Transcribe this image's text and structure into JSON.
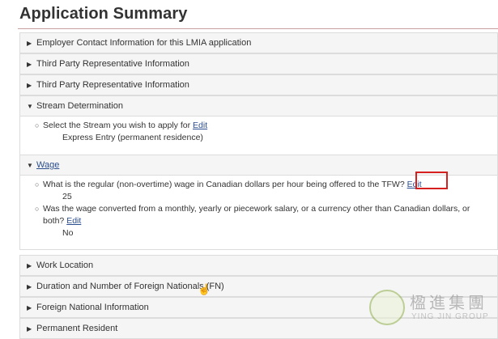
{
  "page": {
    "title": "Application Summary"
  },
  "sections": [
    {
      "label": "Employer Contact Information for this LMIA application",
      "state": "collapsed"
    },
    {
      "label": "Third Party Representative Information",
      "state": "collapsed"
    },
    {
      "label": "Third Party Representative Information",
      "state": "collapsed"
    },
    {
      "label": "Stream Determination",
      "state": "expanded"
    },
    {
      "label": "Wage",
      "state": "expanded"
    },
    {
      "label": "Work Location",
      "state": "collapsed"
    },
    {
      "label": "Duration and Number of Foreign Nationals (FN)",
      "state": "collapsed"
    },
    {
      "label": "Foreign National Information",
      "state": "collapsed"
    },
    {
      "label": "Permanent Resident",
      "state": "collapsed"
    }
  ],
  "stream": {
    "question": "Select the Stream you wish to apply for",
    "edit_label": "Edit",
    "answer": "Express Entry (permanent residence)"
  },
  "wage": {
    "q1": "What is the regular (non-overtime) wage in Canadian dollars per hour being offered to the TFW?",
    "q1_edit": "Edit",
    "a1": "25",
    "q2": "Was the wage converted from a monthly, yearly or piecework salary, or a currency other than Canadian dollars, or both?",
    "q2_edit": "Edit",
    "a2": "No"
  },
  "icons": {
    "collapsed": "▶",
    "expanded": "▼",
    "bullet": "○",
    "cursor": "☝"
  },
  "watermark": {
    "chinese": "楹進集團",
    "english": "YING JIN GROUP"
  },
  "colors": {
    "link": "#2a4d8f",
    "highlight": "#d62020"
  }
}
